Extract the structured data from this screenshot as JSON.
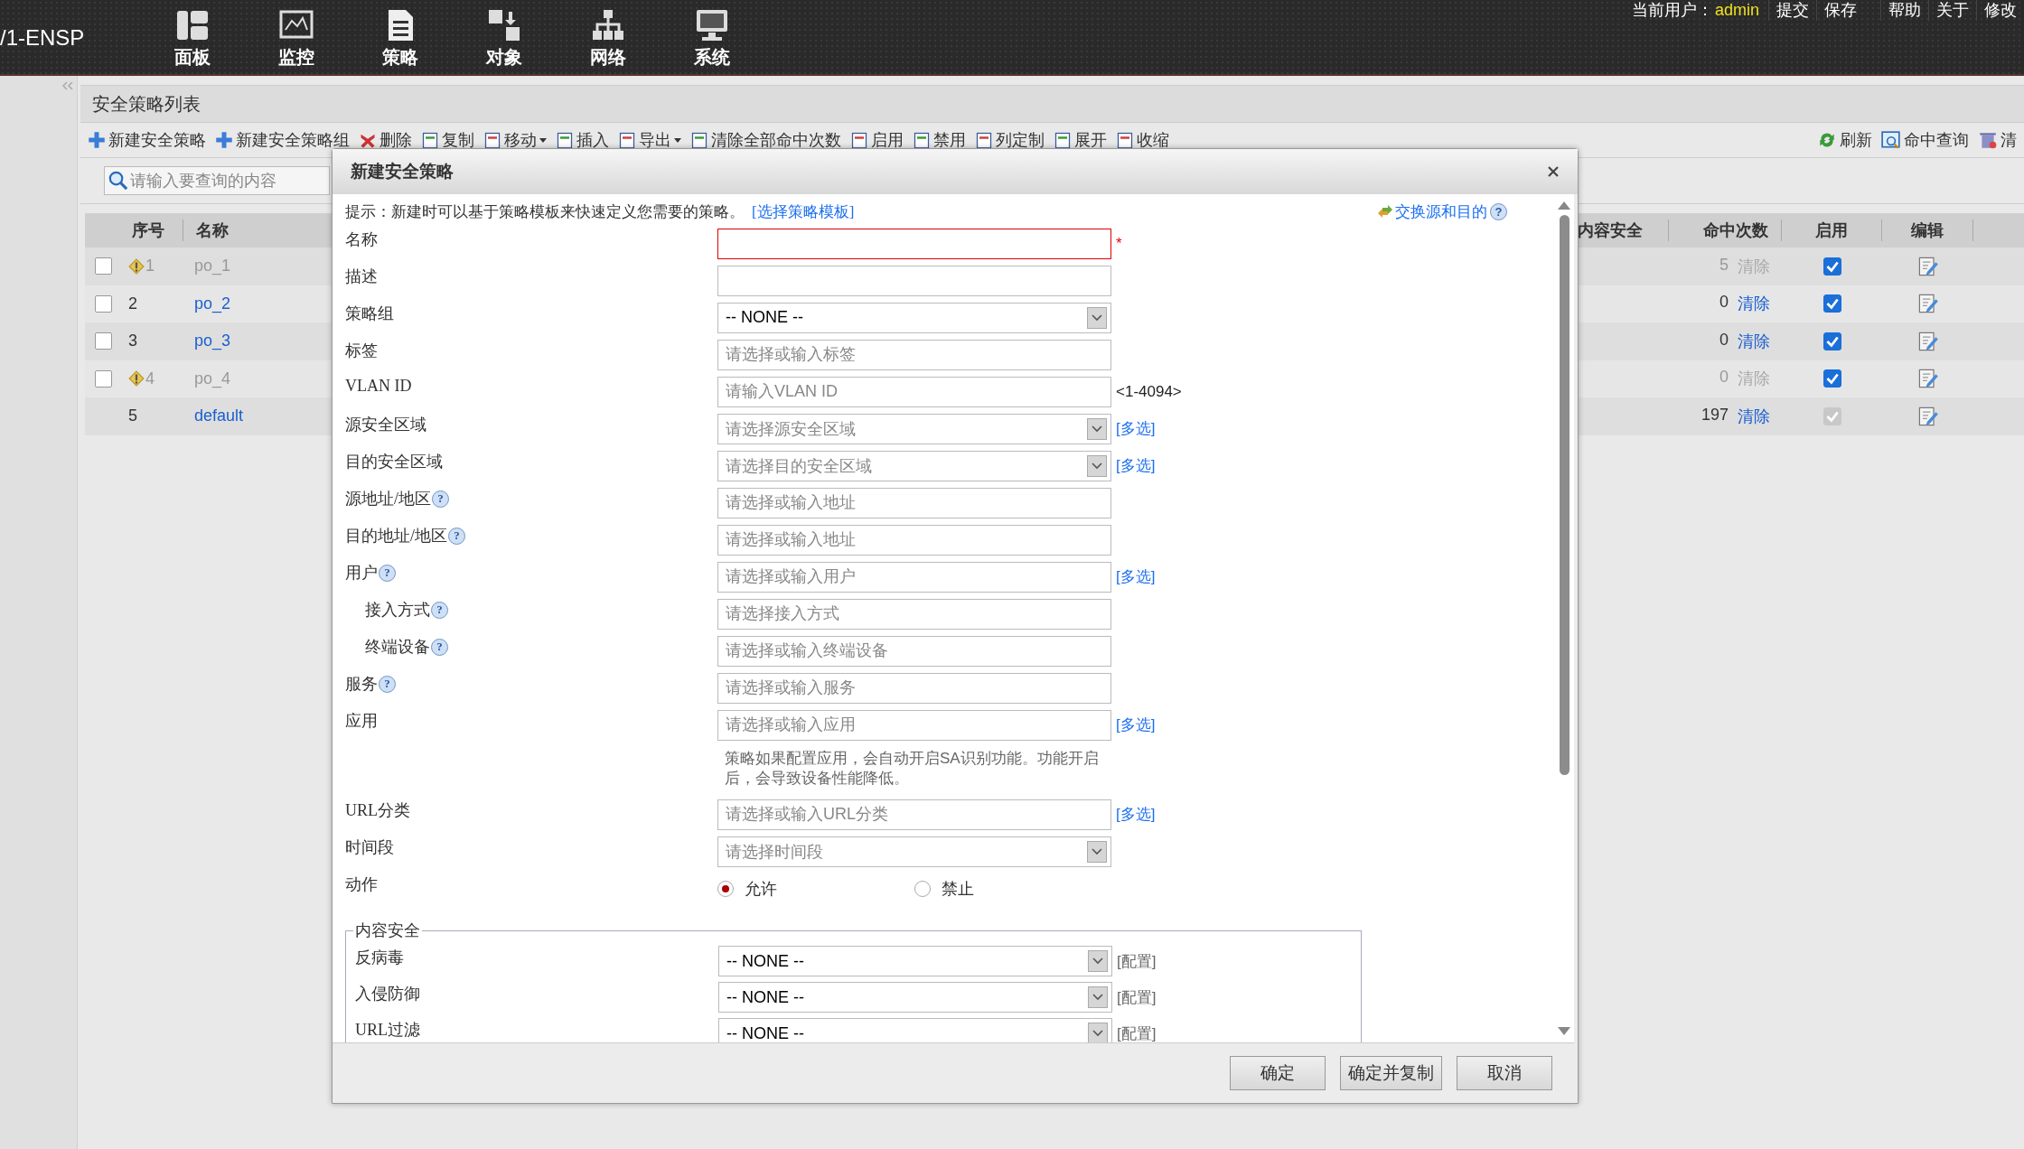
{
  "top_bar": {
    "brand": "/1-ENSP",
    "nav": [
      {
        "label": "面板"
      },
      {
        "label": "监控"
      },
      {
        "label": "策略"
      },
      {
        "label": "对象"
      },
      {
        "label": "网络"
      },
      {
        "label": "系统"
      }
    ],
    "user_label": "当前用户：",
    "user": "admin",
    "links": [
      "提交",
      "保存",
      "帮助",
      "关于",
      "修改"
    ]
  },
  "panel": {
    "title": "安全策略列表",
    "toolbar": [
      {
        "label": "新建安全策略",
        "dropdown": false
      },
      {
        "label": "新建安全策略组",
        "dropdown": false
      },
      {
        "label": "删除",
        "dropdown": false
      },
      {
        "label": "复制",
        "dropdown": false
      },
      {
        "label": "移动",
        "dropdown": true
      },
      {
        "label": "插入",
        "dropdown": false
      },
      {
        "label": "导出",
        "dropdown": true
      },
      {
        "label": "清除全部命中次数",
        "dropdown": false
      },
      {
        "label": "启用",
        "dropdown": false
      },
      {
        "label": "禁用",
        "dropdown": false
      },
      {
        "label": "列定制",
        "dropdown": false
      },
      {
        "label": "展开",
        "dropdown": false
      },
      {
        "label": "收缩",
        "dropdown": false
      }
    ],
    "toolbar_right": [
      "刷新",
      "命中查询",
      "清"
    ],
    "search": {
      "placeholder": "请输入要查询的内容"
    }
  },
  "table": {
    "columns_left": [
      "序号",
      "名称"
    ],
    "columns_right": [
      "内容安全",
      "命中次数",
      "启用",
      "编辑"
    ],
    "rows": [
      {
        "index": "1",
        "name": "po_1",
        "warning": true,
        "disabled": true,
        "selectable": true,
        "hits": "5",
        "clear": "清除",
        "enabled": true,
        "locked": false
      },
      {
        "index": "2",
        "name": "po_2",
        "warning": false,
        "disabled": false,
        "selectable": true,
        "hits": "0",
        "clear": "清除",
        "enabled": true,
        "locked": false
      },
      {
        "index": "3",
        "name": "po_3",
        "warning": false,
        "disabled": false,
        "selectable": true,
        "hits": "0",
        "clear": "清除",
        "enabled": true,
        "locked": false
      },
      {
        "index": "4",
        "name": "po_4",
        "warning": true,
        "disabled": true,
        "selectable": true,
        "hits": "0",
        "clear": "清除",
        "enabled": true,
        "locked": false
      },
      {
        "index": "5",
        "name": "default",
        "warning": false,
        "disabled": false,
        "selectable": false,
        "hits": "197",
        "clear": "清除",
        "enabled": true,
        "locked": true
      }
    ]
  },
  "dialog": {
    "title": "新建安全策略",
    "hint": "提示：新建时可以基于策略模板来快速定义您需要的策略。",
    "hint_link": "[选择策略模板]",
    "swap_link": "交换源和目的",
    "swap_help": "?",
    "fields": [
      {
        "kind": "input",
        "label": "名称",
        "required": "*",
        "invalid": true
      },
      {
        "kind": "input",
        "label": "描述"
      },
      {
        "kind": "select",
        "label": "策略组",
        "value": "-- NONE --"
      },
      {
        "kind": "input",
        "label": "标签",
        "placeholder": "请选择或输入标签"
      },
      {
        "kind": "input",
        "label": "VLAN ID",
        "placeholder": "请输入VLAN ID",
        "extra": "<1-4094>"
      },
      {
        "kind": "select",
        "label": "源安全区域",
        "placeholder": "请选择源安全区域",
        "link": "[多选]"
      },
      {
        "kind": "select",
        "label": "目的安全区域",
        "placeholder": "请选择目的安全区域",
        "link": "[多选]"
      },
      {
        "kind": "input",
        "label": "源地址/地区",
        "help": "?",
        "placeholder": "请选择或输入地址"
      },
      {
        "kind": "input",
        "label": "目的地址/地区",
        "help": "?",
        "placeholder": "请选择或输入地址"
      },
      {
        "kind": "input",
        "label": "用户",
        "help": "?",
        "placeholder": "请选择或输入用户",
        "link": "[多选]",
        "children": [
          {
            "kind": "input",
            "label": "接入方式",
            "help": "?",
            "placeholder": "请选择接入方式"
          },
          {
            "kind": "input",
            "label": "终端设备",
            "help": "?",
            "placeholder": "请选择或输入终端设备"
          }
        ]
      },
      {
        "kind": "input",
        "label": "服务",
        "help": "?",
        "placeholder": "请选择或输入服务"
      },
      {
        "kind": "input",
        "label": "应用",
        "placeholder": "请选择或输入应用",
        "link": "[多选]",
        "note": "策略如果配置应用，会自动开启SA识别功能。功能开启后，会导致设备性能降低。"
      },
      {
        "kind": "input",
        "label": "URL分类",
        "placeholder": "请选择或输入URL分类",
        "link": "[多选]"
      },
      {
        "kind": "select",
        "label": "时间段",
        "placeholder": "请选择时间段"
      },
      {
        "kind": "radio",
        "label": "动作",
        "options": [
          {
            "label": "允许",
            "selected": true
          },
          {
            "label": "禁止",
            "selected": false
          }
        ]
      }
    ],
    "content_security": {
      "legend": "内容安全",
      "rows": [
        {
          "label": "反病毒",
          "value": "-- NONE --",
          "extra": "[配置]"
        },
        {
          "label": "入侵防御",
          "value": "-- NONE --",
          "extra": "[配置]"
        },
        {
          "label": "URL过滤",
          "value": "-- NONE --",
          "extra": "[配置]"
        }
      ]
    },
    "buttons": [
      "确定",
      "确定并复制",
      "取消"
    ]
  }
}
